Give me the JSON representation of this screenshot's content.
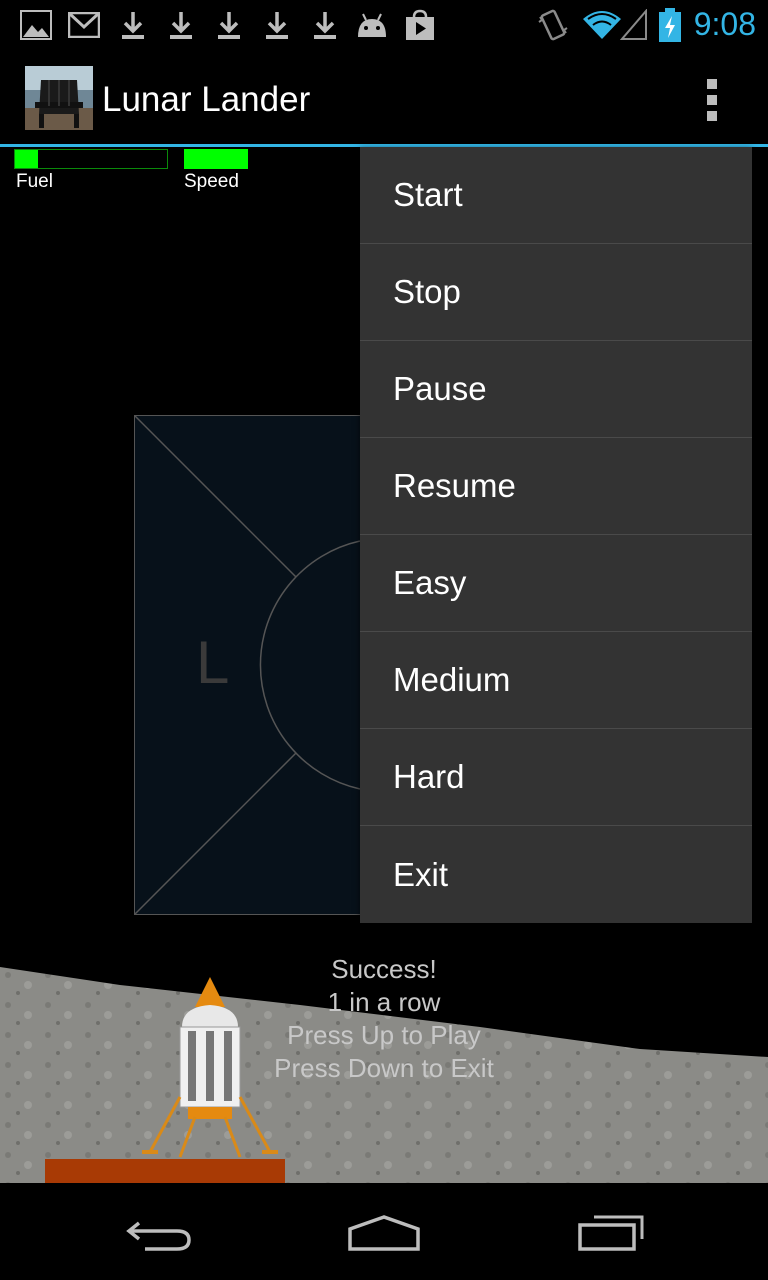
{
  "status_bar": {
    "time": "9:08",
    "notification_icons": [
      "gallery-icon",
      "gmail-icon",
      "download-icon",
      "download-icon",
      "download-icon",
      "download-icon",
      "download-icon",
      "android-icon",
      "play-store-icon"
    ],
    "system_icons": [
      "vibrate-icon",
      "wifi-icon",
      "signal-icon",
      "battery-charging-icon"
    ],
    "accent_color": "#33b5e5"
  },
  "action_bar": {
    "title": "Lunar Lander",
    "icon": "app-icon-adirondack-chair"
  },
  "hud": {
    "fuel_label": "Fuel",
    "speed_label": "Speed",
    "fuel_level": 0.15,
    "gauge_color": "#00ff00"
  },
  "game": {
    "envelope_letter": "L",
    "messages": [
      "Success!",
      "1 in a row",
      "Press Up to Play",
      "Press Down to Exit"
    ]
  },
  "menu": {
    "items": [
      "Start",
      "Stop",
      "Pause",
      "Resume",
      "Easy",
      "Medium",
      "Hard",
      "Exit"
    ]
  },
  "nav_bar": {
    "buttons": [
      "back-icon",
      "home-icon",
      "recents-icon"
    ]
  }
}
